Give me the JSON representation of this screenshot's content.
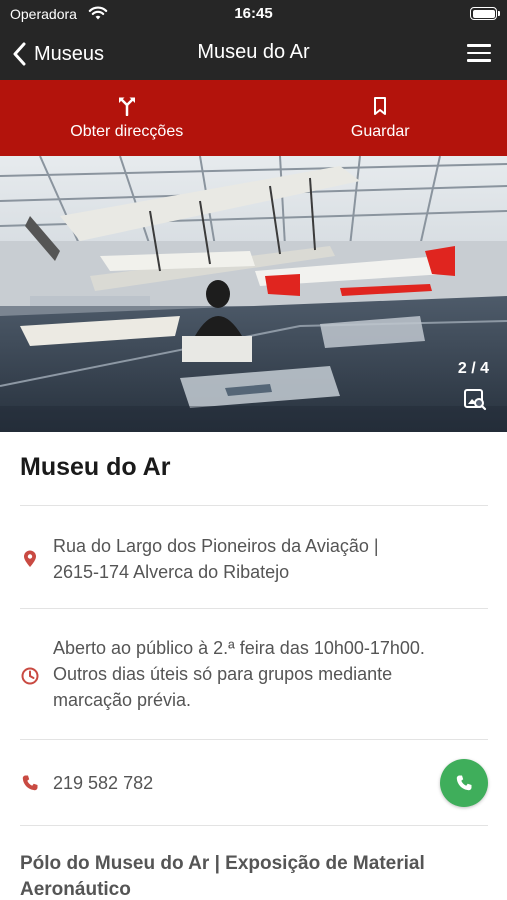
{
  "status_bar": {
    "carrier": "Operadora",
    "time": "16:45"
  },
  "nav": {
    "back_label": "Museus",
    "title": "Museu do Ar"
  },
  "actions": {
    "directions_label": "Obter direcções",
    "save_label": "Guardar"
  },
  "gallery": {
    "counter": "2 / 4"
  },
  "museum": {
    "name": "Museu do Ar",
    "address_line1": "Rua do Largo dos Pioneiros da Aviação |",
    "address_line2": "2615-174 Alverca do Ribatejo",
    "hours_line1": "Aberto ao público à 2.ª feira das 10h00-17h00.",
    "hours_line2": "Outros dias úteis só para grupos mediante",
    "hours_line3": "marcação prévia.",
    "phone": "219 582 782",
    "section_line1": "Pólo do Museu do Ar | Exposição de Material",
    "section_line2": "Aeronáutico"
  },
  "colors": {
    "header_bg": "#262626",
    "accent_red": "#b3130c",
    "icon_red": "#c0392b",
    "call_green": "#3fae5b"
  },
  "icons": [
    "wifi-icon",
    "battery-icon",
    "back-chevron-icon",
    "menu-icon",
    "directions-icon",
    "bookmark-icon",
    "gallery-icon",
    "location-pin-icon",
    "clock-icon",
    "phone-icon",
    "phone-call-icon"
  ]
}
